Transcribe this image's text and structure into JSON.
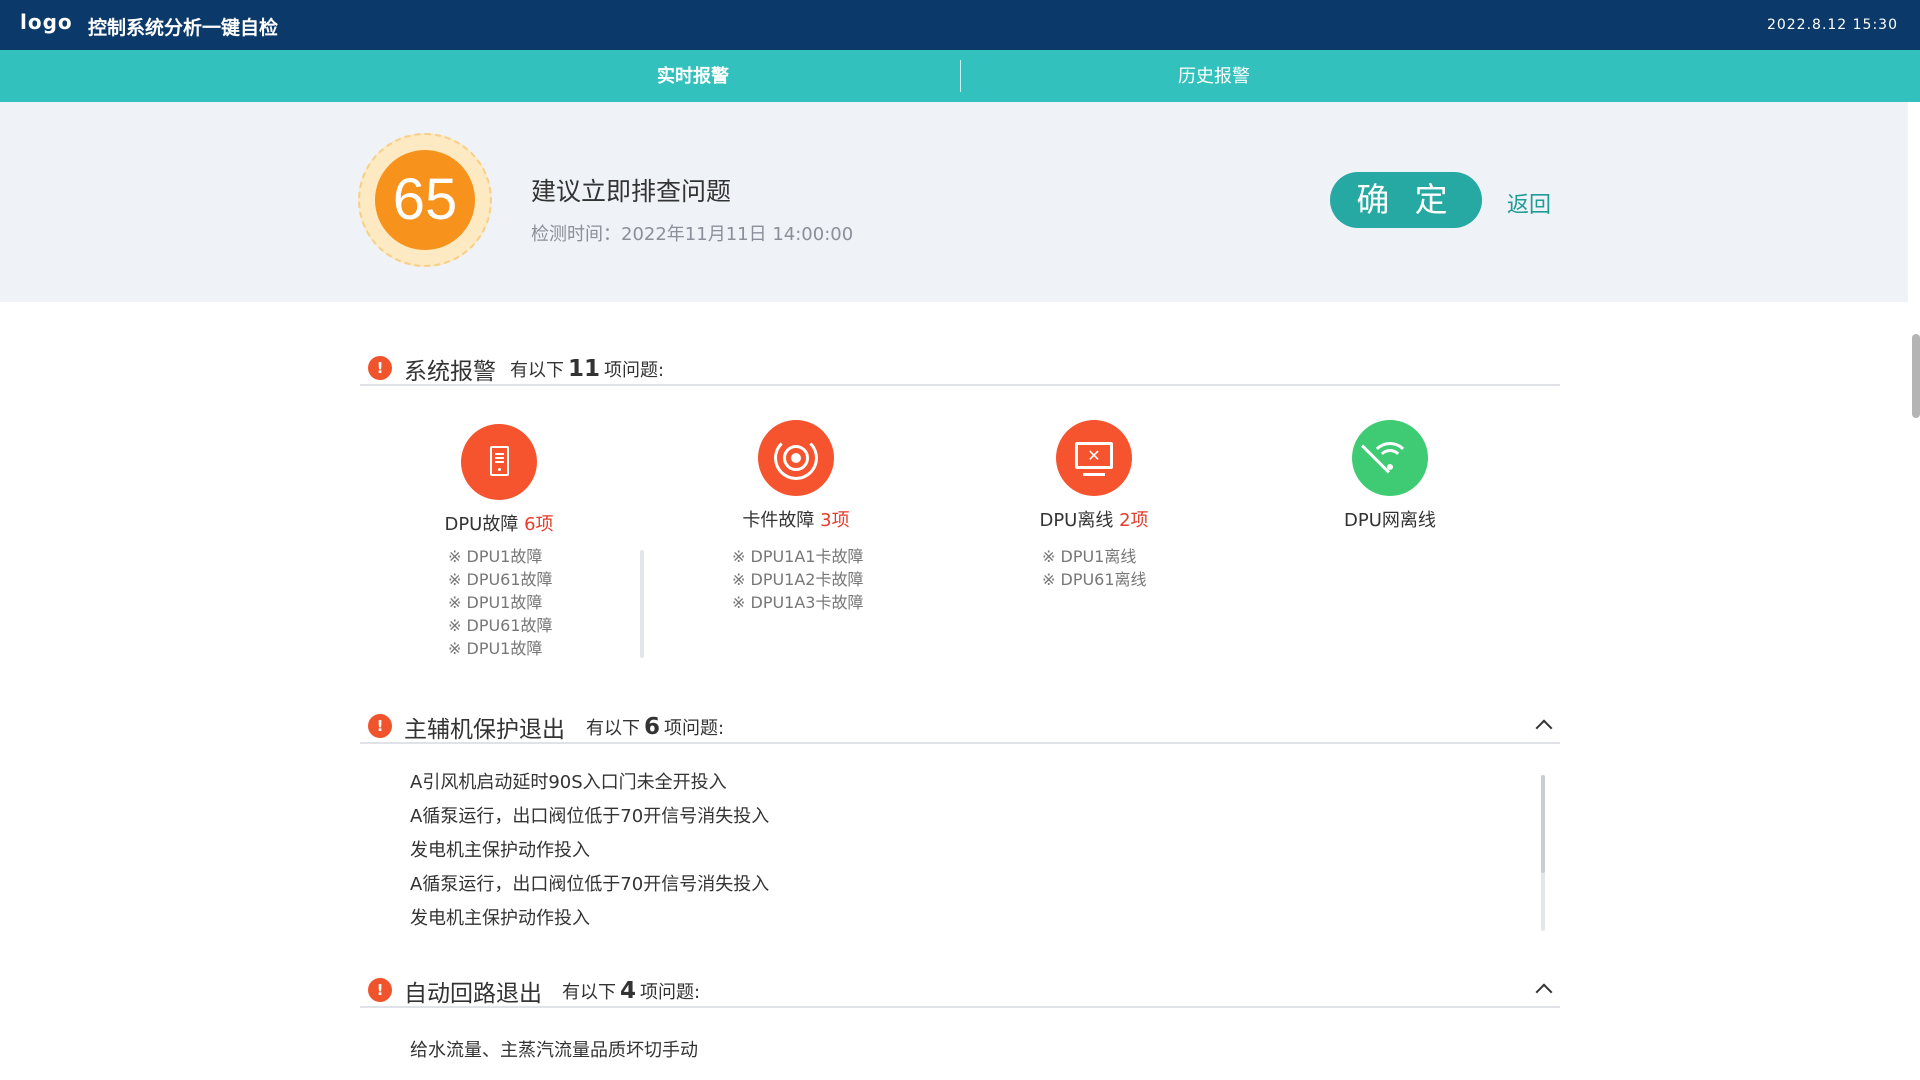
{
  "header": {
    "logo": "logo",
    "title": "控制系统分析一键自检",
    "datetime": "2022.8.12 15:30"
  },
  "tabs": [
    {
      "label": "实时报警",
      "active": true
    },
    {
      "label": "历史报警",
      "active": false
    }
  ],
  "summary": {
    "score": "65",
    "verdict": "建议立即排查问题",
    "check_time": "检测时间：2022年11月11日 14:00:00",
    "confirm_label": "确 定",
    "back_label": "返回"
  },
  "system_alarm": {
    "title": "系统报警",
    "count_prefix": "有以下",
    "count": "11",
    "count_suffix": "项问题:",
    "categories": [
      {
        "name": "DPU故障",
        "count": "6项",
        "icon": "device-icon",
        "color": "#f5542e",
        "items": [
          "※ DPU1故障",
          "※ DPU61故障",
          "※ DPU1故障",
          "※ DPU61故障",
          "※ DPU1故障"
        ]
      },
      {
        "name": "卡件故障",
        "count": "3项",
        "icon": "target-icon",
        "color": "#f5542e",
        "items": [
          "※ DPU1A1卡故障",
          "※ DPU1A2卡故障",
          "※ DPU1A3卡故障"
        ]
      },
      {
        "name": "DPU离线",
        "count": "2项",
        "icon": "screen-offline-icon",
        "color": "#f5542e",
        "items": [
          "※ DPU1离线",
          "※ DPU61离线"
        ]
      },
      {
        "name": "DPU网离线",
        "count": "",
        "icon": "wifi-off-icon",
        "color": "#3fcb73",
        "items": []
      }
    ]
  },
  "protection_exit": {
    "title": "主辅机保护退出",
    "count_prefix": "有以下",
    "count": "6",
    "count_suffix": "项问题:",
    "items": [
      "A引风机启动延时90S入口门未全开投入",
      "A循泵运行，出口阀位低于70开信号消失投入",
      "发电机主保护动作投入",
      "A循泵运行，出口阀位低于70开信号消失投入",
      "发电机主保护动作投入"
    ]
  },
  "auto_loop_exit": {
    "title": "自动回路退出",
    "count_prefix": "有以下",
    "count": "4",
    "count_suffix": "项问题:",
    "items": [
      "给水流量、主蒸汽流量品质坏切手动"
    ]
  },
  "colors": {
    "header_bg": "#0b3a6a",
    "tab_bg": "#33c1bd",
    "score_orange": "#f7921c",
    "confirm_bg": "#26a9a3",
    "alarm_red": "#f0542d",
    "ok_green": "#3fcb73"
  }
}
